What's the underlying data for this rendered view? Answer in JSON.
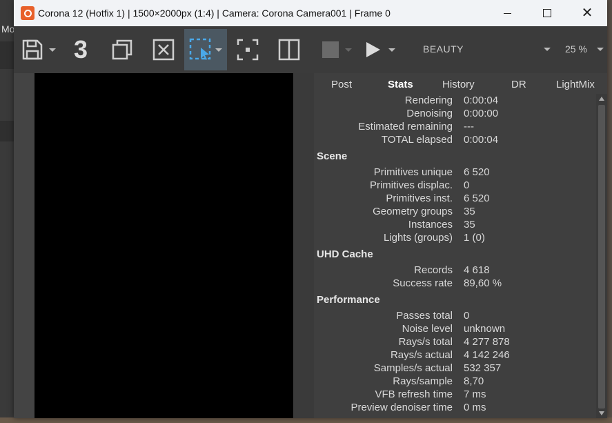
{
  "background_app": {
    "menu_fragment": "Mo"
  },
  "window": {
    "title": "Corona 12 (Hotfix 1) | 1500×2000px (1:4) | Camera: Corona Camera001 | Frame 0",
    "controls": {
      "minimize": "minimize-icon",
      "maximize": "maximize-icon",
      "close": "close-icon"
    }
  },
  "toolbar": {
    "three_label": "3",
    "render_element": "BEAUTY",
    "zoom": "25 %",
    "icons": [
      "save-icon",
      "copy-icon",
      "clear-icon",
      "region-select-icon",
      "focus-icon",
      "split-view-icon",
      "stop-icon",
      "render-icon"
    ]
  },
  "panel": {
    "tabs": [
      {
        "label": "Post"
      },
      {
        "label": "Stats",
        "active": true
      },
      {
        "label": "History"
      },
      {
        "label": "DR"
      },
      {
        "label": "LightMix"
      }
    ],
    "timing": [
      {
        "key": "Rendering",
        "value": "0:00:04"
      },
      {
        "key": "Denoising",
        "value": "0:00:00"
      },
      {
        "key": "Estimated remaining",
        "value": "---"
      },
      {
        "key": "TOTAL elapsed",
        "value": "0:00:04"
      }
    ],
    "scene": {
      "title": "Scene",
      "rows": [
        {
          "key": "Primitives unique",
          "value": "6 520"
        },
        {
          "key": "Primitives displac.",
          "value": "0"
        },
        {
          "key": "Primitives inst.",
          "value": "6 520"
        },
        {
          "key": "Geometry groups",
          "value": "35"
        },
        {
          "key": "Instances",
          "value": "35"
        },
        {
          "key": "Lights (groups)",
          "value": "1 (0)"
        }
      ]
    },
    "uhd": {
      "title": "UHD Cache",
      "rows": [
        {
          "key": "Records",
          "value": "4 618"
        },
        {
          "key": "Success rate",
          "value": "89,60 %"
        }
      ]
    },
    "performance": {
      "title": "Performance",
      "rows": [
        {
          "key": "Passes total",
          "value": "0"
        },
        {
          "key": "Noise level",
          "value": "unknown"
        },
        {
          "key": "Rays/s total",
          "value": "4 277 878"
        },
        {
          "key": "Rays/s actual",
          "value": "4 142 246"
        },
        {
          "key": "Samples/s actual",
          "value": "532 357"
        },
        {
          "key": "Rays/sample",
          "value": "8,70"
        },
        {
          "key": "VFB refresh time",
          "value": "7 ms"
        },
        {
          "key": "Preview denoiser time",
          "value": "0 ms"
        }
      ]
    }
  }
}
